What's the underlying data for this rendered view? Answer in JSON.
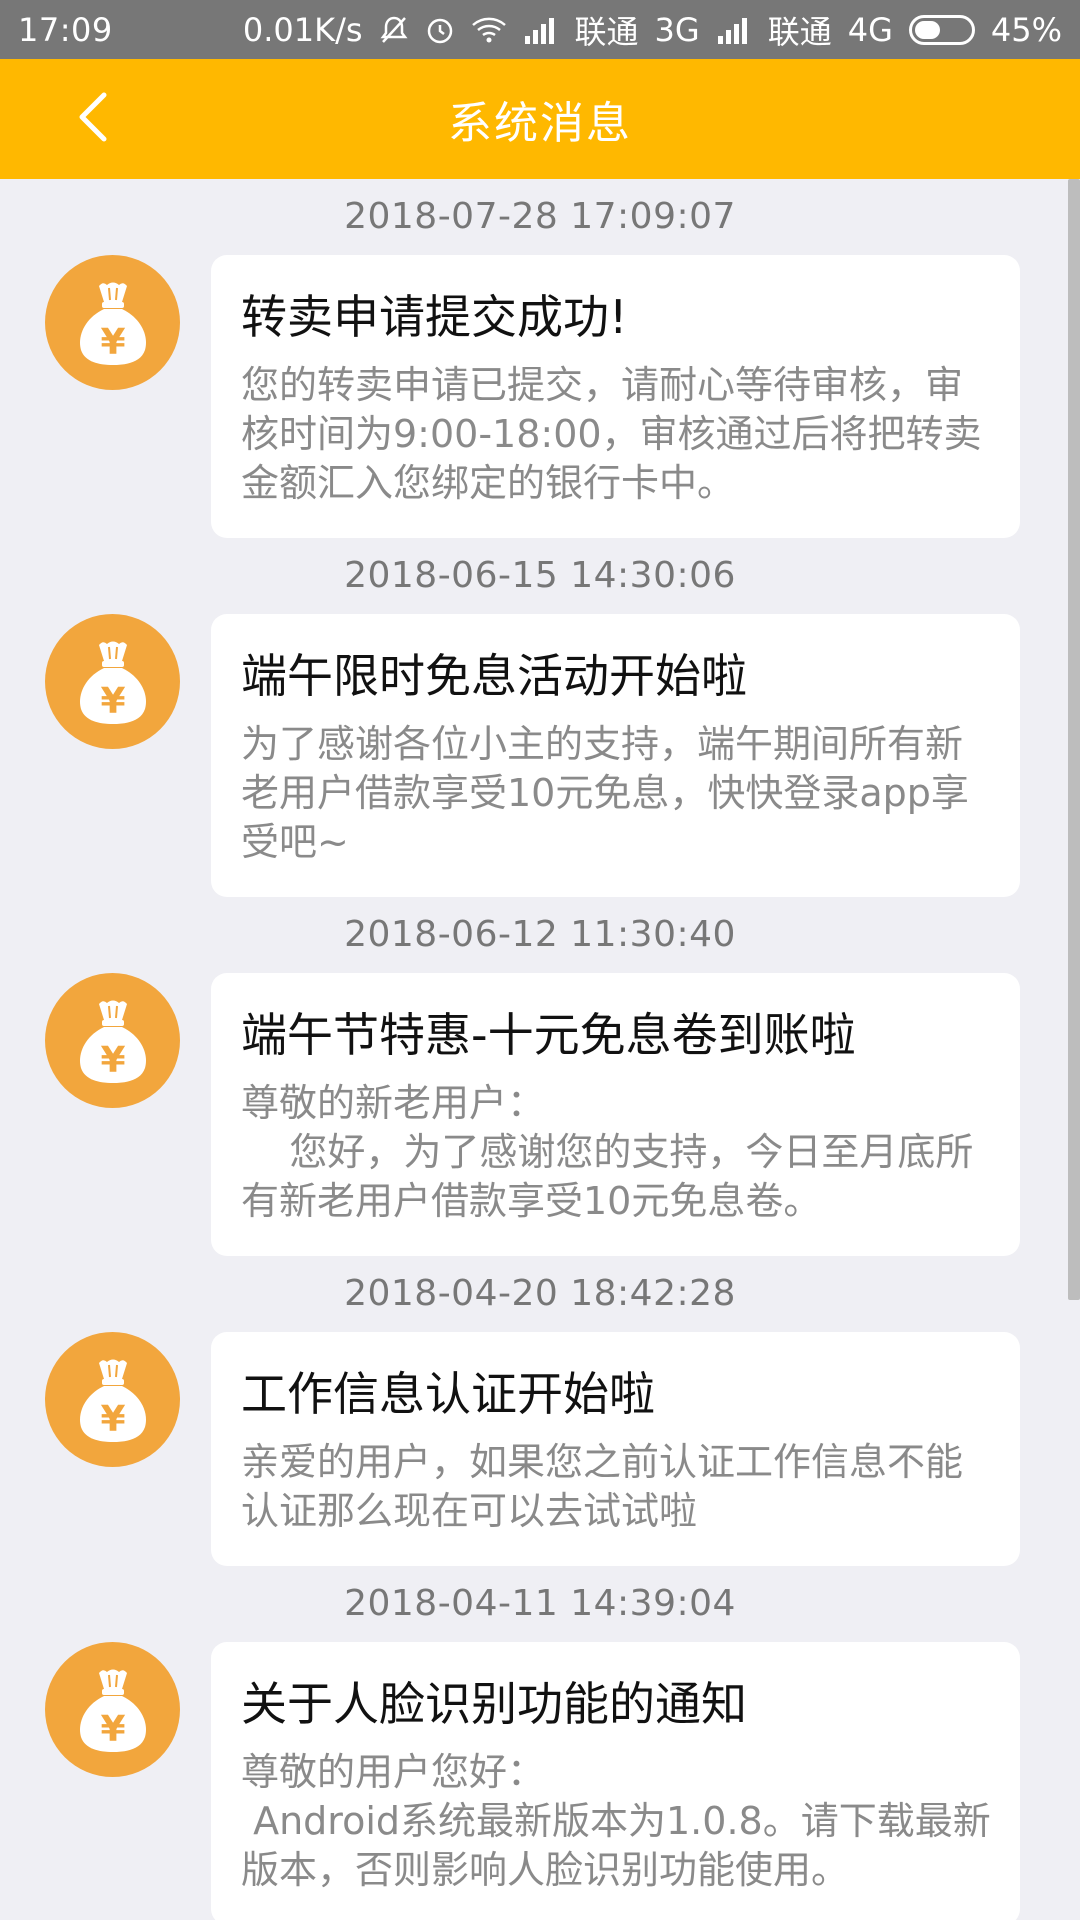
{
  "status_bar": {
    "time": "17:09",
    "speed": "0.01K/s",
    "carrier1": "联通",
    "network1": "3G",
    "carrier2": "联通",
    "network2": "4G",
    "battery": "45%"
  },
  "header": {
    "title": "系统消息",
    "back_icon": "chevron-left-icon"
  },
  "colors": {
    "header_bg": "#ffb800",
    "avatar_bg": "#f2a63d",
    "page_bg": "#efeff4"
  },
  "messages": [
    {
      "timestamp": "2018-07-28 17:09:07",
      "title": "转卖申请提交成功!",
      "body": "您的转卖申请已提交，请耐心等待审核，审核时间为9:00-18:00，审核通过后将把转卖金额汇入您绑定的银行卡中。"
    },
    {
      "timestamp": "2018-06-15 14:30:06",
      "title": "端午限时免息活动开始啦",
      "body": "为了感谢各位小主的支持，端午期间所有新老用户借款享受10元免息，快快登录app享受吧~"
    },
    {
      "timestamp": "2018-06-12 11:30:40",
      "title": "端午节特惠-十元免息卷到账啦",
      "body": "尊敬的新老用户：\n    您好，为了感谢您的支持，今日至月底所有新老用户借款享受10元免息卷。"
    },
    {
      "timestamp": "2018-04-20 18:42:28",
      "title": "工作信息认证开始啦",
      "body": "亲爱的用户，如果您之前认证工作信息不能认证那么现在可以去试试啦"
    },
    {
      "timestamp": "2018-04-11 14:39:04",
      "title": "关于人脸识别功能的通知",
      "body": "尊敬的用户您好：\n Android系统最新版本为1.0.8。请下载最新版本，否则影响人脸识别功能使用。"
    }
  ]
}
